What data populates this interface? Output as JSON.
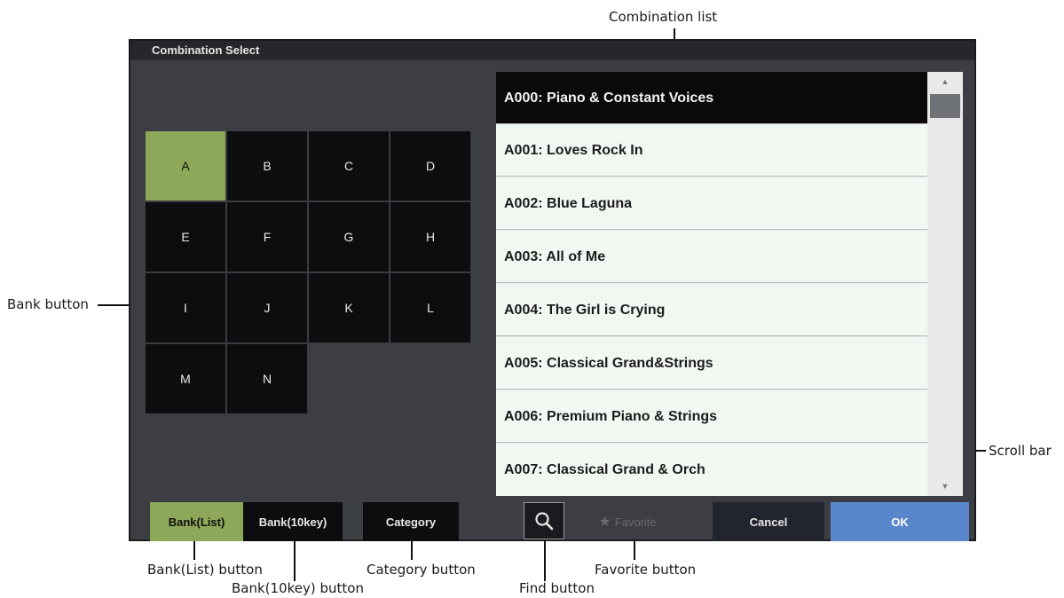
{
  "dialog": {
    "title": "Combination Select"
  },
  "banks": [
    "A",
    "B",
    "C",
    "D",
    "E",
    "F",
    "G",
    "H",
    "I",
    "J",
    "K",
    "L",
    "M",
    "N"
  ],
  "combinations": [
    "A000: Piano & Constant Voices",
    "A001: Loves Rock In",
    "A002: Blue Laguna",
    "A003: All of Me",
    "A004: The Girl is Crying",
    "A005: Classical Grand&Strings",
    "A006: Premium Piano & Strings",
    "A007: Classical Grand & Orch"
  ],
  "buttons": {
    "bank_list": "Bank(List)",
    "bank_10key": "Bank(10key)",
    "category": "Category",
    "favorite": "Favorite",
    "cancel": "Cancel",
    "ok": "OK"
  },
  "icons": {
    "find": "magnifier-icon",
    "favorite": "star-icon",
    "scroll_up": "triangle-up-icon",
    "scroll_down": "triangle-down-icon"
  },
  "annotations": {
    "combination_list": "Combination list",
    "bank_button": "Bank button",
    "scroll_bar": "Scroll bar",
    "bank_list_button": "Bank(List) button",
    "bank_10key_button": "Bank(10key) button",
    "category_button": "Category button",
    "find_button": "Find button",
    "favorite_button": "Favorite button"
  },
  "colors": {
    "selected_green": "#8ea85a",
    "ok_blue": "#5a86cc",
    "dialog_bg": "#3d3d44",
    "list_row_bg": "#f1f8f2"
  }
}
